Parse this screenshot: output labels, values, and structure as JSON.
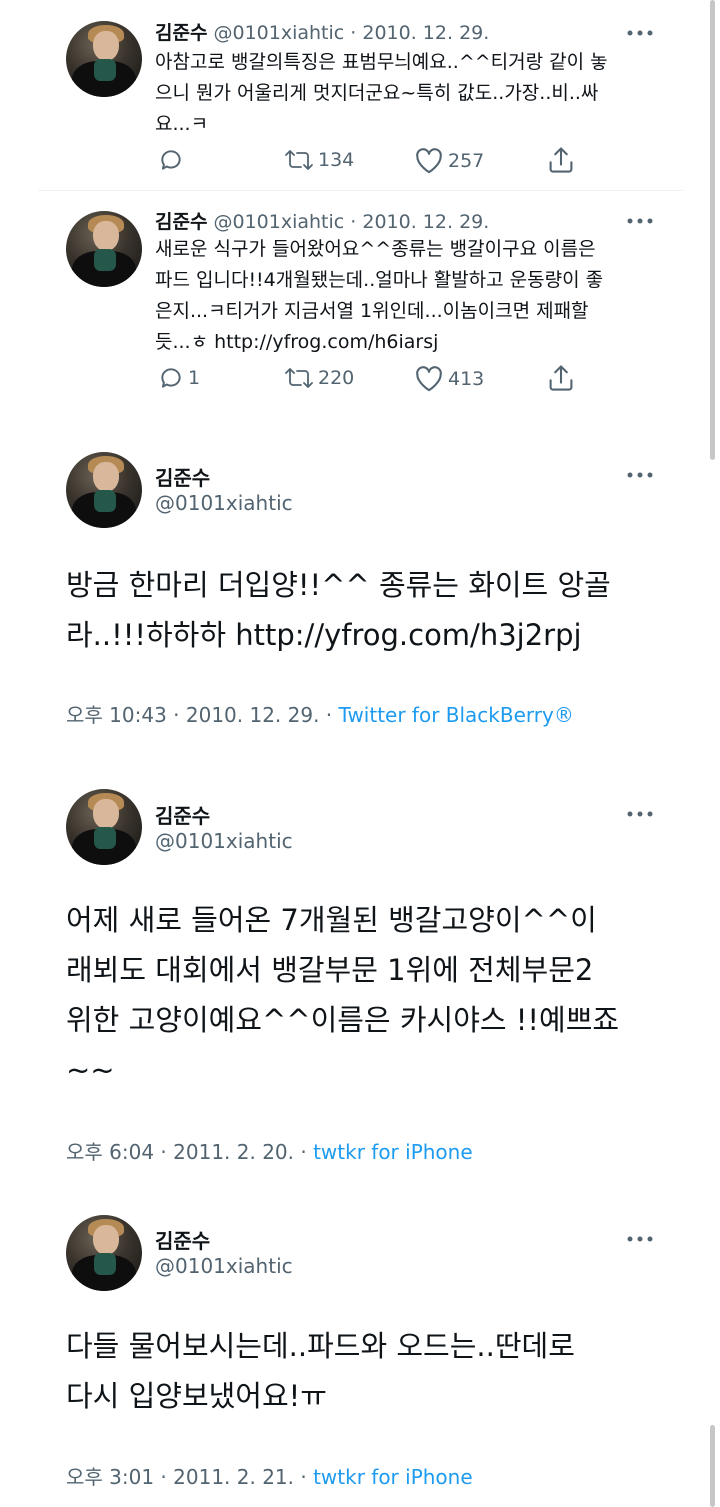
{
  "tweets_compact": [
    {
      "name": "김준수",
      "handle": "@0101xiahtic",
      "date": "· 2010. 12. 29.",
      "lines": [
        "아참고로 뱅갈의특징은 표범무늬예요..^^티거랑 같이 놓",
        "으니 뭔가 어울리게 멋지더군요~특히 값도..가장..비..싸",
        "요...ㅋ"
      ],
      "reply_count": "",
      "retweet_count": "134",
      "like_count": "257"
    },
    {
      "name": "김준수",
      "handle": "@0101xiahtic",
      "date": "· 2010. 12. 29.",
      "lines": [
        "새로운 식구가 들어왔어요^^종류는 뱅갈이구요 이름은",
        "파드 입니다!!4개월됐는데..얼마나 활발하고 운동량이 좋",
        "은지...ㅋ티거가 지금서열 1위인데...이놈이크면 제패할",
        "듯...ㅎ http://yfrog.com/h6iarsj"
      ],
      "reply_count": "1",
      "retweet_count": "220",
      "like_count": "413"
    }
  ],
  "tweets_detail": [
    {
      "name": "김준수",
      "handle": "@0101xiahtic",
      "lines": [
        "방금 한마리 더입양!!^^ 종류는 화이트 앙골",
        "라..!!!하하하 http://yfrog.com/h3j2rpj"
      ],
      "time": "오후 10:43 · 2010. 12. 29. · ",
      "source": "Twitter for BlackBerry®"
    },
    {
      "name": "김준수",
      "handle": "@0101xiahtic",
      "lines": [
        "어제 새로 들어온 7개월된 뱅갈고양이^^이",
        "래뵈도 대회에서 뱅갈부문 1위에 전체부문2",
        "위한 고양이예요^^이름은 카시야스 !!예쁘죠",
        "~~"
      ],
      "time": "오후 6:04 · 2011. 2. 20. · ",
      "source": "twtkr for iPhone"
    },
    {
      "name": "김준수",
      "handle": "@0101xiahtic",
      "lines": [
        "다들 물어보시는데..파드와 오드는..딴데로",
        "다시 입양보냈어요!ㅠ"
      ],
      "time": "오후 3:01 · 2011. 2. 21. · ",
      "source": "twtkr for iPhone"
    }
  ],
  "colors": {
    "text": "#0f1419",
    "secondary": "#536471",
    "link": "#1d9bf0",
    "divider": "#eff3f4"
  },
  "icons": [
    "more-icon",
    "reply-icon",
    "retweet-icon",
    "like-icon",
    "share-icon"
  ]
}
